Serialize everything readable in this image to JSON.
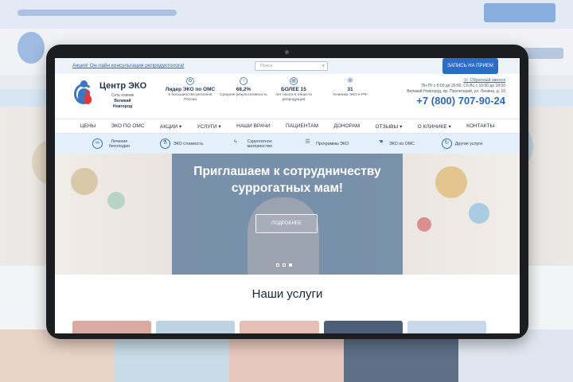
{
  "topbar": {
    "promo": "Акция! Он-лайн консультация репродуктолога!",
    "search_placeholder": "Поиск",
    "appointment_button": "ЗАПИСЬ НА ПРИЕМ"
  },
  "brand": {
    "name": "Центр ЭКО",
    "subtitle": "Сеть клиник",
    "city": "Великий Новгород"
  },
  "stats": [
    {
      "icon": "award-icon",
      "big": "Лидер ЭКО по ОМС",
      "small": "в большинстве регионов России"
    },
    {
      "icon": "chart-icon",
      "big": "68,2%",
      "small": "Средняя результативность"
    },
    {
      "icon": "calendar-icon",
      "big": "БОЛЕЕ 15",
      "small": "лет опыта в области репродукции"
    },
    {
      "icon": "snowflake-icon",
      "big": "31",
      "small": "Клиника ЭКО в РФ"
    }
  ],
  "contact": {
    "callback": "Обратный звонок",
    "hours": "Пн-Пт с 9:00 до 20:00, Сб-Вс с 10:00 до 18:00",
    "address": "Великий Новгород, пр. Пролетарий, ул. Ленина, д. 10",
    "phone": "+7 (800) 707-90-24"
  },
  "nav": {
    "items": [
      "ЦЕНЫ",
      "ЭКО ПО ОМС",
      "АКЦИИ ▾",
      "УСЛУГИ ▾",
      "НАШИ ВРАЧИ",
      "ПАЦИЕНТАМ",
      "ДОНОРАМ",
      "ОТЗЫВЫ ▾",
      "О КЛИНИКЕ ▾",
      "КОНТАКТЫ"
    ]
  },
  "subnav": {
    "items": [
      {
        "icon": "rings-icon",
        "label": "Лечение бесплодия"
      },
      {
        "icon": "flask-icon",
        "label": "ЭКО стоимость"
      },
      {
        "icon": "pregnancy-icon",
        "label": "Суррогатное материнство"
      },
      {
        "icon": "list-icon",
        "label": "Программы ЭКО"
      },
      {
        "icon": "hand-icon",
        "label": "ЭКО по ОМС"
      },
      {
        "icon": "refresh-icon",
        "label": "Другие услуги"
      }
    ]
  },
  "hero": {
    "title": "Приглашаем к сотрудничеству суррогатных мам!",
    "button": "ПОДРОБНЕЕ",
    "slides": 3,
    "active_slide": 3
  },
  "services": {
    "heading": "Наши услуги"
  },
  "colors": {
    "accent": "#2f6cc4",
    "nav_sub_bg": "#e3f0fb",
    "hero_overlay": "#46699180",
    "device": "#1c1d20"
  }
}
